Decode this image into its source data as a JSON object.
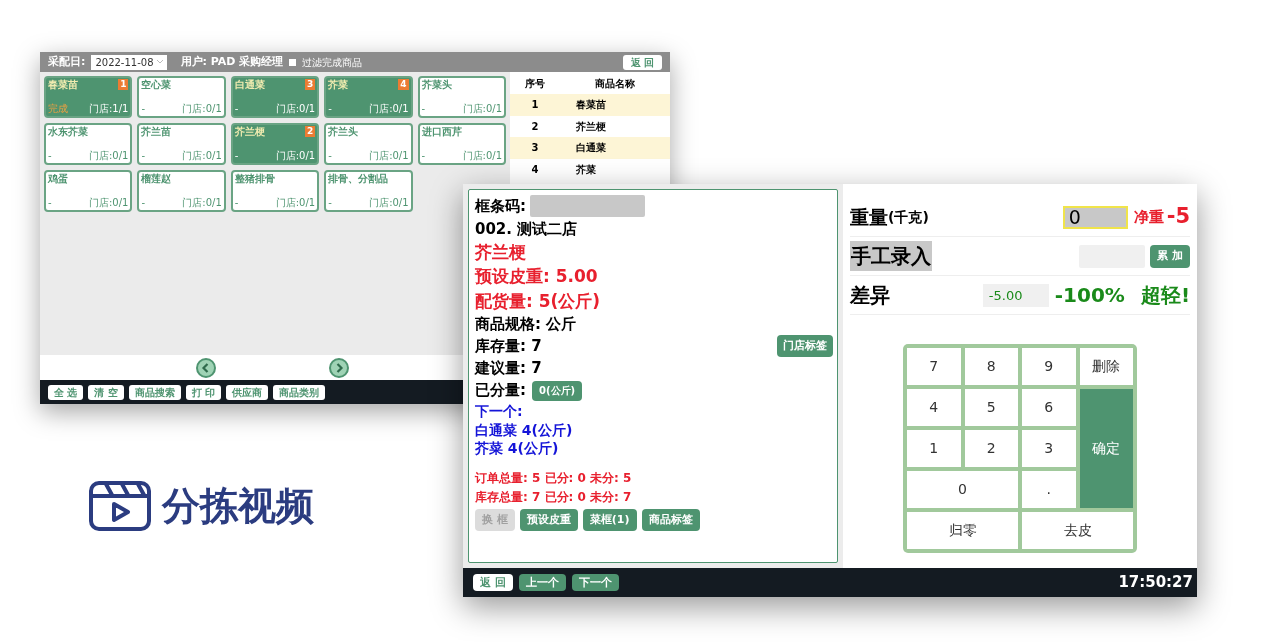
{
  "back_window": {
    "header": {
      "date_label": "采配日:",
      "date": "2022-11-08",
      "user": "用户: PAD 采购经理",
      "filter": {
        "label": "过滤完成商品",
        "checked": false
      },
      "back_button": "返 回"
    },
    "tiles": [
      {
        "name": "春菜苗",
        "badge": "1",
        "status": "完成",
        "stores": "门店:1/1",
        "selected": true
      },
      {
        "name": "空心菜",
        "status": "-",
        "stores": "门店:0/1",
        "selected": false
      },
      {
        "name": "白通菜",
        "badge": "3",
        "status": "-",
        "stores": "门店:0/1",
        "selected": true
      },
      {
        "name": "芥菜",
        "badge": "4",
        "status": "-",
        "stores": "门店:0/1",
        "selected": true
      },
      {
        "name": "芥菜头",
        "status": "-",
        "stores": "门店:0/1",
        "selected": false
      },
      {
        "name": "水东芥菜",
        "status": "-",
        "stores": "门店:0/1",
        "selected": false
      },
      {
        "name": "芥兰苗",
        "status": "-",
        "stores": "门店:0/1",
        "selected": false
      },
      {
        "name": "芥兰梗",
        "badge": "2",
        "status": "-",
        "stores": "门店:0/1",
        "selected": true
      },
      {
        "name": "芥兰头",
        "status": "-",
        "stores": "门店:0/1",
        "selected": false
      },
      {
        "name": "进口西芹",
        "status": "-",
        "stores": "门店:0/1",
        "selected": false
      },
      {
        "name": "鸡蛋",
        "status": "-",
        "stores": "门店:0/1",
        "selected": false
      },
      {
        "name": "榴莲赵",
        "status": "-",
        "stores": "门店:0/1",
        "selected": false
      },
      {
        "name": "整猪排骨",
        "status": "-",
        "stores": "门店:0/1",
        "selected": false
      },
      {
        "name": "排骨、分割品",
        "status": "-",
        "stores": "门店:0/1",
        "selected": false
      }
    ],
    "table": {
      "columns": [
        "序号",
        "商品名称"
      ],
      "rows": [
        {
          "cells": [
            "1",
            "春菜苗"
          ]
        },
        {
          "cells": [
            "2",
            "芥兰梗"
          ]
        },
        {
          "cells": [
            "3",
            "白通菜"
          ]
        },
        {
          "cells": [
            "4",
            "芥菜"
          ]
        }
      ]
    },
    "toolbar": [
      "全 选",
      "清 空",
      "商品搜索",
      "打 印",
      "供应商",
      "商品类别"
    ]
  },
  "front_window": {
    "barcode_label": "框条码:",
    "store": "002. 测试二店",
    "product": "芥兰梗",
    "tare": "预设皮重: 5.00",
    "allocation": "配货量: 5(公斤)",
    "spec": "商品规格: 公斤",
    "stock": "库存量: 7",
    "store_label_button": "门店标签",
    "suggested": "建议量: 7",
    "sorted_label": "已分量:",
    "sorted_value": "0(公斤)",
    "next_label": "下一个:",
    "next_items": [
      "白通菜 4(公斤)",
      "芥菜 4(公斤)"
    ],
    "totals": [
      "订单总量: 5 已分: 0 未分: 5",
      "库存总量: 7 已分: 0 未分: 7"
    ],
    "actions": [
      {
        "label": "换 框",
        "disabled": true
      },
      {
        "label": "预设皮重",
        "disabled": false
      },
      {
        "label": "菜框(1)",
        "disabled": false
      },
      {
        "label": "商品标签",
        "disabled": false
      }
    ],
    "weight_label": "重量",
    "weight_unit": "(千克)",
    "weight_value": "0",
    "net_label": "净重",
    "net_value": "-5",
    "manual_label": "手工录入",
    "add_button": "累 加",
    "diff_label": "差异",
    "diff_value": "-5.00",
    "diff_percent": "-100%",
    "verdict": "超轻!",
    "keys": [
      {
        "label": "7",
        "kind": "key"
      },
      {
        "label": "8",
        "kind": "key"
      },
      {
        "label": "9",
        "kind": "key"
      },
      {
        "label": "删除",
        "kind": "key"
      },
      {
        "label": "4",
        "kind": "key"
      },
      {
        "label": "5",
        "kind": "key"
      },
      {
        "label": "6",
        "kind": "key"
      },
      {
        "label": "1",
        "kind": "key"
      },
      {
        "label": "2",
        "kind": "key"
      },
      {
        "label": "3",
        "kind": "key"
      },
      {
        "label": "确定",
        "kind": "confirm"
      },
      {
        "label": "0",
        "kind": "key"
      },
      {
        "label": ".",
        "kind": "key"
      },
      {
        "label": "归零",
        "kind": "key"
      },
      {
        "label": "去皮",
        "kind": "key"
      }
    ],
    "bottom_buttons": [
      {
        "label": "返 回",
        "kind": "plain"
      },
      {
        "label": "上一个",
        "kind": "green"
      },
      {
        "label": "下一个",
        "kind": "green"
      }
    ],
    "time": "17:50:27"
  },
  "logo": {
    "text": "分拣视频"
  }
}
